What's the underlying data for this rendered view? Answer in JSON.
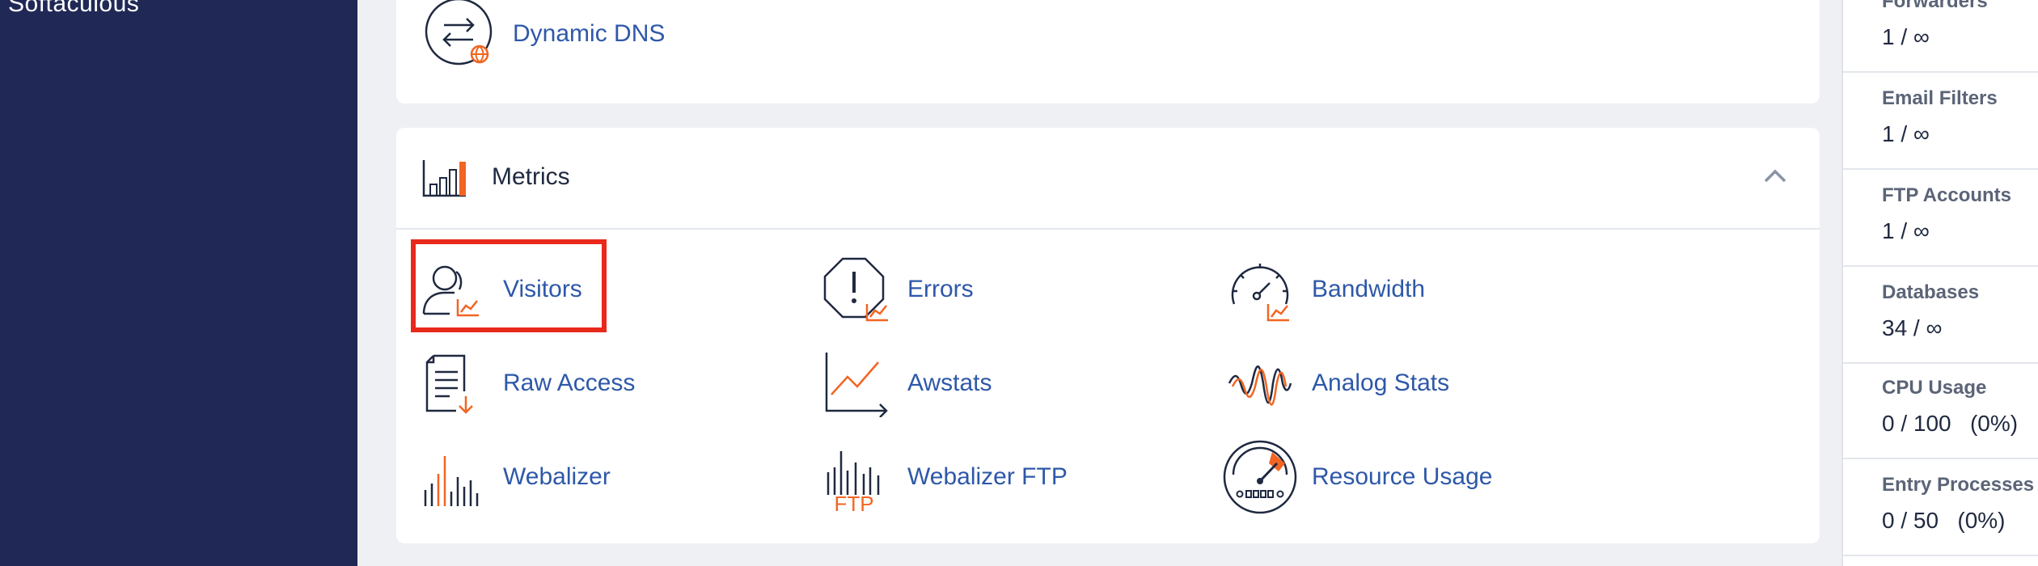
{
  "sidebar": {
    "items": [
      {
        "label": "Softaculous"
      }
    ]
  },
  "top_panel": {
    "items": [
      {
        "label": "Dynamic DNS",
        "icon": "dynamic-dns-icon"
      }
    ]
  },
  "metrics": {
    "title": "Metrics",
    "items": [
      {
        "label": "Visitors",
        "icon": "visitors-icon"
      },
      {
        "label": "Errors",
        "icon": "errors-icon"
      },
      {
        "label": "Bandwidth",
        "icon": "bandwidth-icon"
      },
      {
        "label": "Raw Access",
        "icon": "raw-access-icon"
      },
      {
        "label": "Awstats",
        "icon": "awstats-icon"
      },
      {
        "label": "Analog Stats",
        "icon": "analog-stats-icon"
      },
      {
        "label": "Webalizer",
        "icon": "webalizer-icon"
      },
      {
        "label": "Webalizer FTP",
        "icon": "webalizer-ftp-icon",
        "icon_text": "FTP"
      },
      {
        "label": "Resource Usage",
        "icon": "resource-usage-icon"
      }
    ]
  },
  "stats": [
    {
      "label": "Forwarders",
      "value": "1 / ∞"
    },
    {
      "label": "Email Filters",
      "value": "1 / ∞"
    },
    {
      "label": "FTP Accounts",
      "value": "1 / ∞"
    },
    {
      "label": "Databases",
      "value": "34 / ∞"
    },
    {
      "label": "CPU Usage",
      "value": "0 / 100   (0%)"
    },
    {
      "label": "Entry Processes",
      "value": "0 / 50   (0%)"
    }
  ],
  "colors": {
    "accent": "#f26522",
    "link": "#2e58a8",
    "sidebar": "#202856",
    "highlight": "#e8291c"
  }
}
